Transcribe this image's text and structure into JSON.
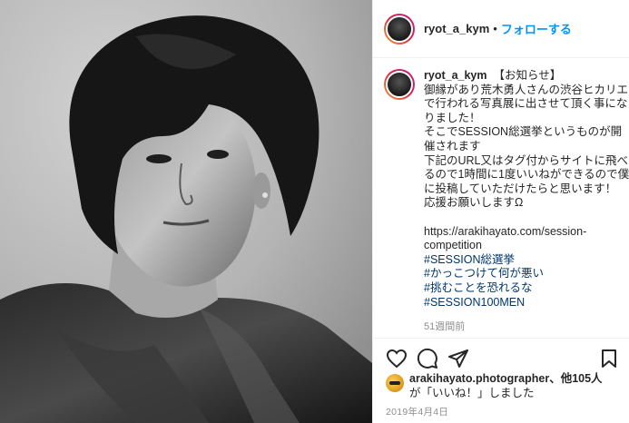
{
  "post": {
    "username": "ryot_a_kym",
    "follow_label": "フォローする",
    "dot": "•"
  },
  "caption": {
    "username": "ryot_a_kym",
    "lines": [
      "【お知らせ】",
      "御縁があり荒木勇人さんの渋谷ヒカリエ",
      "で行われる写真展に出させて頂く事にな",
      "りました！",
      "そこでSESSION総選挙というものが開",
      "催されます",
      "下記のURL又はタグ付からサイトに飛べ",
      "るので1時間に1度いいねができるので僕",
      "に投稿していただけたらと思います！",
      "応援お願いしますΩ"
    ],
    "link_line1": "https://arakihayato.com/session-",
    "link_line2": "competition",
    "hashtags": [
      "#SESSION総選挙",
      "#かっこつけて何が悪い",
      "#挑むことを恐れるな",
      "#SESSION100MEN"
    ],
    "time": "51週間前"
  },
  "actions": {
    "like_icon": "heart-icon",
    "comment_icon": "comment-icon",
    "share_icon": "share-icon",
    "save_icon": "bookmark-icon"
  },
  "likes": {
    "user": "arakihayato.photographer",
    "suffix": "、他105人",
    "line2": "が「いいね！」しました"
  },
  "date": "2019年4月4日"
}
